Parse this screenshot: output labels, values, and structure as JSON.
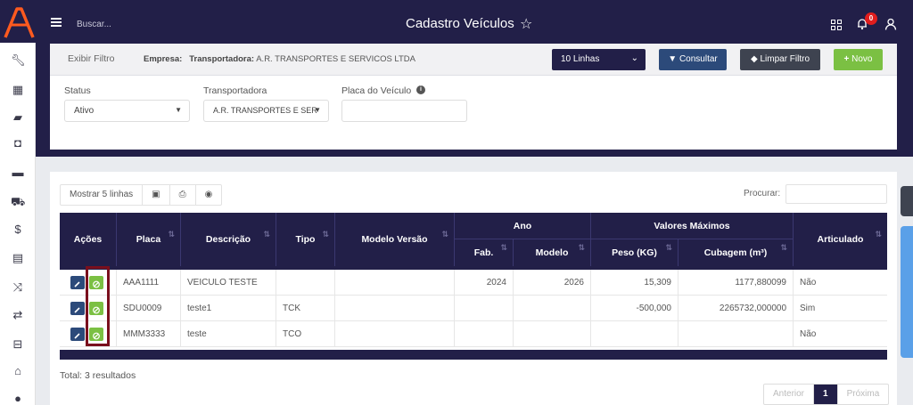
{
  "header": {
    "search_placeholder": "Buscar...",
    "title": "Cadastro Veículos",
    "notification_count": "0"
  },
  "filter": {
    "toggle_label": "Exibir Filtro",
    "empresa_label": "Empresa:",
    "transportadora_label": "Transportadora:",
    "transportadora_value": "A.R. TRANSPORTES E SERVICOS LTDA",
    "lines_select": "10 Linhas",
    "consultar_label": "Consultar",
    "limpar_label": "Limpar Filtro",
    "novo_label": "Novo",
    "fields": {
      "status_label": "Status",
      "status_value": "Ativo",
      "transportadora_field_label": "Transportadora",
      "transportadora_field_value": "A.R. TRANSPORTES E SER",
      "placa_label": "Placa do Veículo"
    }
  },
  "table_tools": {
    "show_rows": "Mostrar 5 linhas",
    "search_label": "Procurar:"
  },
  "table": {
    "headers": {
      "acoes": "Ações",
      "placa": "Placa",
      "descricao": "Descrição",
      "tipo": "Tipo",
      "modelo_versao": "Modelo Versão",
      "ano": "Ano",
      "fab": "Fab.",
      "modelo": "Modelo",
      "valores_maximos": "Valores Máximos",
      "peso": "Peso (KG)",
      "cubagem": "Cubagem (m³)",
      "articulado": "Articulado"
    },
    "rows": [
      {
        "placa": "AAA1111",
        "descricao": "VEICULO TESTE",
        "tipo": "",
        "modelo_versao": "",
        "fab": "2024",
        "modelo": "2026",
        "peso": "15,309",
        "cubagem": "1177,880099",
        "articulado": "Não"
      },
      {
        "placa": "SDU0009",
        "descricao": "teste1",
        "tipo": "TCK",
        "modelo_versao": "",
        "fab": "",
        "modelo": "",
        "peso": "-500,000",
        "cubagem": "2265732,000000",
        "articulado": "Sim"
      },
      {
        "placa": "MMM3333",
        "descricao": "teste",
        "tipo": "TCO",
        "modelo_versao": "",
        "fab": "",
        "modelo": "",
        "peso": "",
        "cubagem": "",
        "articulado": "Não"
      }
    ]
  },
  "footer": {
    "total": "Total: 3 resultados",
    "prev": "Anterior",
    "page": "1",
    "next": "Próxima"
  },
  "colors": {
    "navy": "#221f48",
    "green": "#7bc043",
    "blue": "#2c4a7a",
    "highlight": "#7a0f1d"
  }
}
